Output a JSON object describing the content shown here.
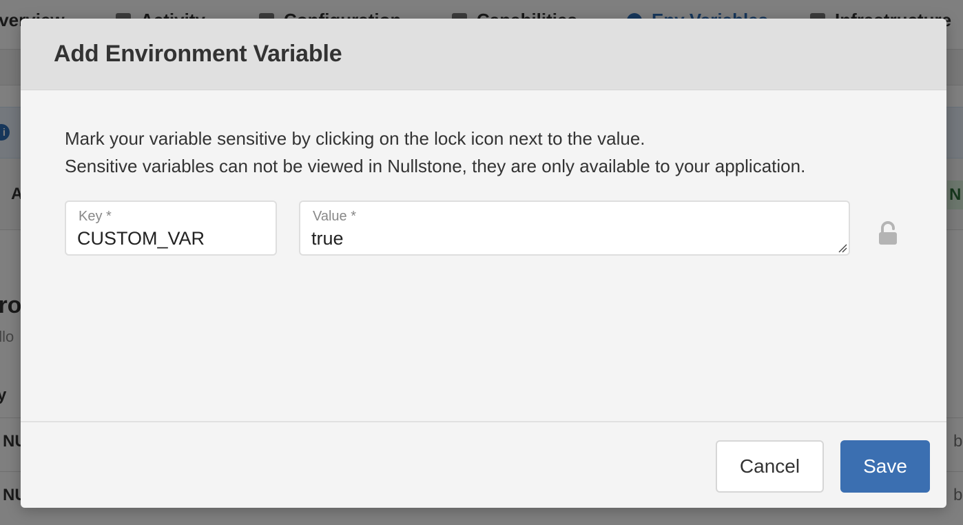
{
  "background": {
    "tabs": [
      {
        "label": "Overview",
        "icon": "grid-icon"
      },
      {
        "label": "Activity",
        "icon": "list-icon"
      },
      {
        "label": "Configuration",
        "icon": "sliders-icon"
      },
      {
        "label": "Capabilities",
        "icon": "tag-icon"
      },
      {
        "label": "Env Variables",
        "icon": "info-icon"
      },
      {
        "label": "Infrastructure",
        "icon": "blocks-icon"
      }
    ],
    "info_glyph": "i",
    "row_label": "A",
    "row_badge": "N",
    "heading": "iro",
    "subtext": "ollo",
    "column_header": "y",
    "rows": [
      {
        "key": "NU",
        "right": "b"
      },
      {
        "key": "NU",
        "right": "b"
      }
    ]
  },
  "modal": {
    "title": "Add Environment Variable",
    "help_lines": [
      "Mark your variable sensitive by clicking on the lock icon next to the value.",
      "Sensitive variables can not be viewed in Nullstone, they are only available to your application."
    ],
    "key_field": {
      "label": "Key *",
      "value": "CUSTOM_VAR"
    },
    "value_field": {
      "label": "Value *",
      "value": "true"
    },
    "lock_icon": "unlock-icon",
    "cancel_label": "Cancel",
    "save_label": "Save"
  },
  "colors": {
    "primary": "#3b6fb1",
    "header_bg": "#e0e0e0",
    "body_bg": "#f4f4f4",
    "icon_gray": "#b4b4b4"
  }
}
